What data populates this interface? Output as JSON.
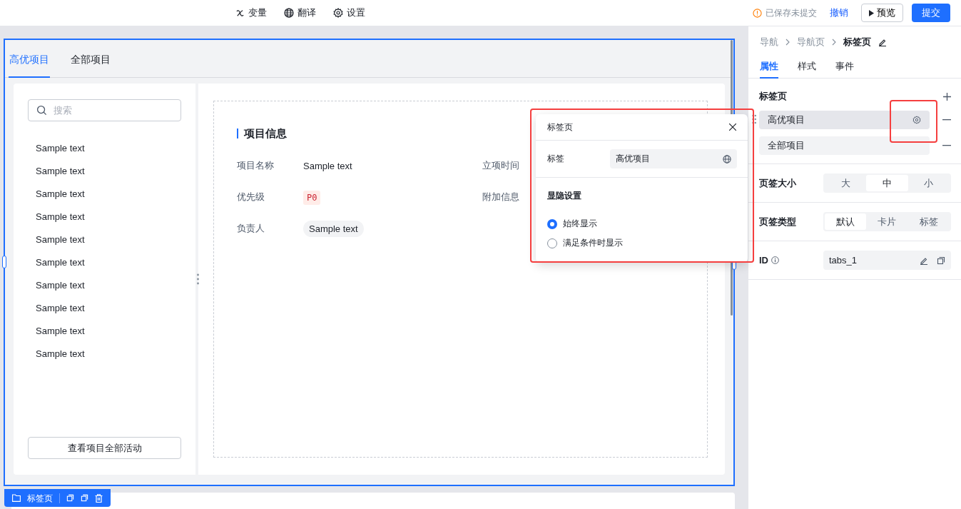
{
  "toolbar": {
    "items": [
      {
        "kind": "variable",
        "label": "变量"
      },
      {
        "kind": "translate",
        "label": "翻译"
      },
      {
        "kind": "settings",
        "label": "设置"
      }
    ],
    "status": "已保存未提交",
    "undo": "撤销",
    "preview": "预览",
    "submit": "提交"
  },
  "canvas": {
    "tabs": [
      {
        "label": "高优项目",
        "selected": true
      },
      {
        "label": "全部项目",
        "selected": false
      }
    ],
    "search": {
      "placeholder": "搜索"
    },
    "list": [
      "Sample text",
      "Sample text",
      "Sample text",
      "Sample text",
      "Sample text",
      "Sample text",
      "Sample text",
      "Sample text",
      "Sample text",
      "Sample text"
    ],
    "activity_button": "查看项目全部活动",
    "section_title": "项目信息",
    "fields": [
      {
        "label": "项目名称",
        "kind": "text",
        "value": "Sample text"
      },
      {
        "label": "立项时间",
        "kind": "empty"
      },
      {
        "label": "优先级",
        "kind": "tag",
        "value": "P0"
      },
      {
        "label": "附加信息",
        "kind": "empty"
      },
      {
        "label": "负责人",
        "kind": "chip",
        "value": "Sample text"
      }
    ],
    "component_label": "标签页"
  },
  "popover": {
    "title": "标签页",
    "field": {
      "label": "标签",
      "value": "高优项目"
    },
    "visibility": {
      "title": "显隐设置",
      "options": [
        {
          "label": "始终显示",
          "selected": true
        },
        {
          "label": "满足条件时显示",
          "selected": false
        }
      ]
    }
  },
  "panel": {
    "breadcrumb": [
      "导航",
      "导航页",
      "标签页"
    ],
    "tabs": [
      {
        "label": "属性",
        "selected": true
      },
      {
        "label": "样式",
        "selected": false
      },
      {
        "label": "事件",
        "selected": false
      }
    ],
    "tab_pages": {
      "title": "标签页",
      "items": [
        "高优项目",
        "全部项目"
      ]
    },
    "size": {
      "label": "页签大小",
      "options": [
        {
          "label": "大",
          "selected": false
        },
        {
          "label": "中",
          "selected": true
        },
        {
          "label": "小",
          "selected": false
        }
      ]
    },
    "type": {
      "label": "页签类型",
      "options": [
        {
          "label": "默认",
          "selected": true
        },
        {
          "label": "卡片",
          "selected": false
        },
        {
          "label": "标签",
          "selected": false
        }
      ]
    },
    "id": {
      "label": "ID",
      "value": "tabs_1"
    }
  }
}
